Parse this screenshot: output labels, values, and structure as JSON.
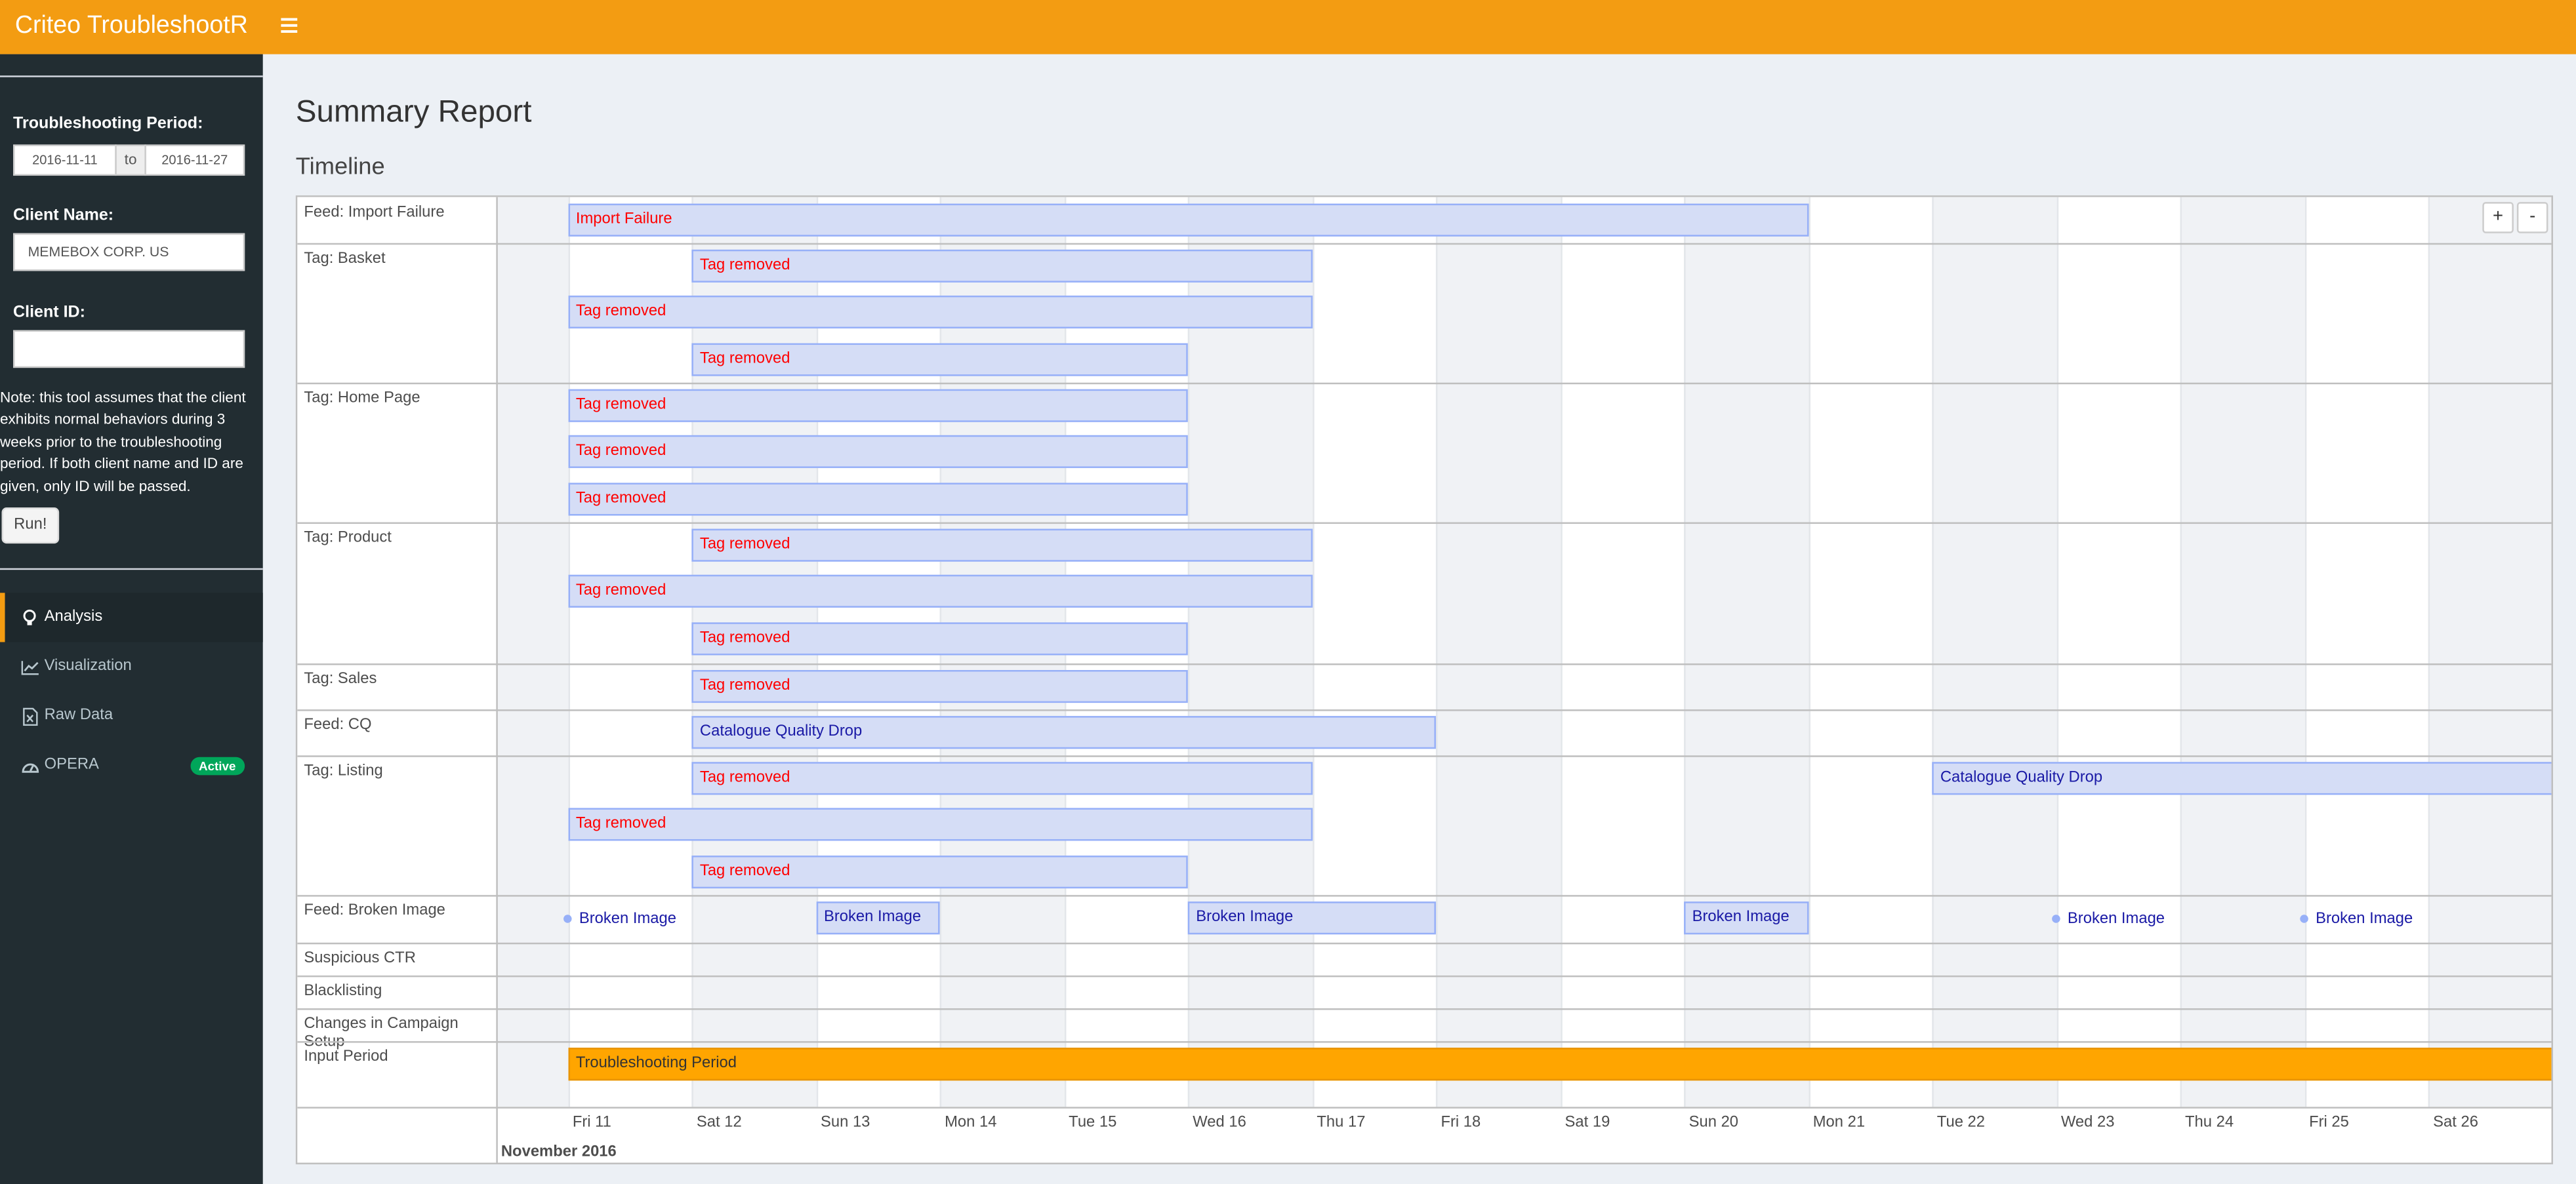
{
  "header": {
    "app_title": "Criteo TroubleshootR",
    "menu_toggle_icon": "hamburger-icon"
  },
  "sidebar": {
    "period_label": "Troubleshooting Period:",
    "date_from": "2016-11-11",
    "date_sep": "to",
    "date_to": "2016-11-27",
    "client_name_label": "Client Name:",
    "client_name_value": "MEMEBOX CORP. US",
    "client_id_label": "Client ID:",
    "client_id_value": "",
    "note": "Note: this tool assumes that the client exhibits normal behaviors during 3 weeks prior to the troubleshooting period. If both client name and ID are given, only ID will be passed.",
    "run_label": "Run!",
    "menu": [
      {
        "label": "Analysis",
        "icon": "lightbulb-icon",
        "active": true
      },
      {
        "label": "Visualization",
        "icon": "line-chart-icon",
        "active": false
      },
      {
        "label": "Raw Data",
        "icon": "file-excel-icon",
        "active": false
      },
      {
        "label": "OPERA",
        "icon": "dashboard-icon",
        "active": false,
        "badge": "Active"
      }
    ]
  },
  "main": {
    "page_title": "Summary Report",
    "section_title": "Timeline"
  },
  "timeline": {
    "zoom_in_label": "+",
    "zoom_out_label": "-",
    "month_label": "November 2016",
    "days": [
      "Fri 11",
      "Sat 12",
      "Sun 13",
      "Mon 14",
      "Tue 15",
      "Wed 16",
      "Thu 17",
      "Fri 18",
      "Sat 19",
      "Sun 20",
      "Mon 21",
      "Tue 22",
      "Wed 23",
      "Thu 24",
      "Fri 25",
      "Sat 26"
    ],
    "groups": [
      "Feed: Import Failure",
      "Tag: Basket",
      "Tag: Home Page",
      "Tag: Product",
      "Tag: Sales",
      "Feed: CQ",
      "Tag: Listing",
      "Feed: Broken Image",
      "Suspicious CTR",
      "Blacklisting",
      "Changes in Campaign Setup",
      "Input Period"
    ],
    "items": [
      {
        "group": "Feed: Import Failure",
        "text": "Import Failure",
        "start": "2016-11-11",
        "end": "2016-11-21",
        "style": "red"
      },
      {
        "group": "Tag: Basket",
        "text": "Tag removed",
        "start": "2016-11-12",
        "end": "2016-11-17",
        "style": "red"
      },
      {
        "group": "Tag: Basket",
        "text": "Tag removed",
        "start": "2016-11-11",
        "end": "2016-11-17",
        "style": "red"
      },
      {
        "group": "Tag: Basket",
        "text": "Tag removed",
        "start": "2016-11-12",
        "end": "2016-11-16",
        "style": "red"
      },
      {
        "group": "Tag: Home Page",
        "text": "Tag removed",
        "start": "2016-11-11",
        "end": "2016-11-16",
        "style": "red"
      },
      {
        "group": "Tag: Home Page",
        "text": "Tag removed",
        "start": "2016-11-11",
        "end": "2016-11-16",
        "style": "red"
      },
      {
        "group": "Tag: Home Page",
        "text": "Tag removed",
        "start": "2016-11-11",
        "end": "2016-11-16",
        "style": "red"
      },
      {
        "group": "Tag: Product",
        "text": "Tag removed",
        "start": "2016-11-12",
        "end": "2016-11-17",
        "style": "red"
      },
      {
        "group": "Tag: Product",
        "text": "Tag removed",
        "start": "2016-11-11",
        "end": "2016-11-17",
        "style": "red"
      },
      {
        "group": "Tag: Product",
        "text": "Tag removed",
        "start": "2016-11-12",
        "end": "2016-11-16",
        "style": "red"
      },
      {
        "group": "Tag: Sales",
        "text": "Tag removed",
        "start": "2016-11-12",
        "end": "2016-11-16",
        "style": "red"
      },
      {
        "group": "Feed: CQ",
        "text": "Catalogue Quality Drop",
        "start": "2016-11-12",
        "end": "2016-11-18",
        "style": "blue"
      },
      {
        "group": "Feed: CQ",
        "text": "Catalogue Quality Drop",
        "start": "2016-11-22",
        "end": "2016-11-27",
        "style": "blue"
      },
      {
        "group": "Tag: Listing",
        "text": "Tag removed",
        "start": "2016-11-12",
        "end": "2016-11-17",
        "style": "red"
      },
      {
        "group": "Tag: Listing",
        "text": "Tag removed",
        "start": "2016-11-11",
        "end": "2016-11-17",
        "style": "red"
      },
      {
        "group": "Tag: Listing",
        "text": "Tag removed",
        "start": "2016-11-12",
        "end": "2016-11-16",
        "style": "red"
      },
      {
        "group": "Feed: Broken Image",
        "text": "Broken Image",
        "start": "2016-11-11",
        "type": "point",
        "style": "blue"
      },
      {
        "group": "Feed: Broken Image",
        "text": "Broken Image",
        "start": "2016-11-13",
        "end": "2016-11-14",
        "style": "blue"
      },
      {
        "group": "Feed: Broken Image",
        "text": "Broken Image",
        "start": "2016-11-16",
        "end": "2016-11-18",
        "style": "blue"
      },
      {
        "group": "Feed: Broken Image",
        "text": "Broken Image",
        "start": "2016-11-20",
        "end": "2016-11-21",
        "style": "blue"
      },
      {
        "group": "Feed: Broken Image",
        "text": "Broken Image",
        "start": "2016-11-23",
        "type": "point",
        "style": "blue"
      },
      {
        "group": "Feed: Broken Image",
        "text": "Broken Image",
        "start": "2016-11-25",
        "type": "point",
        "style": "blue"
      },
      {
        "group": "Input Period",
        "text": "Troubleshooting Period",
        "start": "2016-11-11",
        "end": "2016-11-27",
        "style": "orange"
      }
    ]
  }
}
